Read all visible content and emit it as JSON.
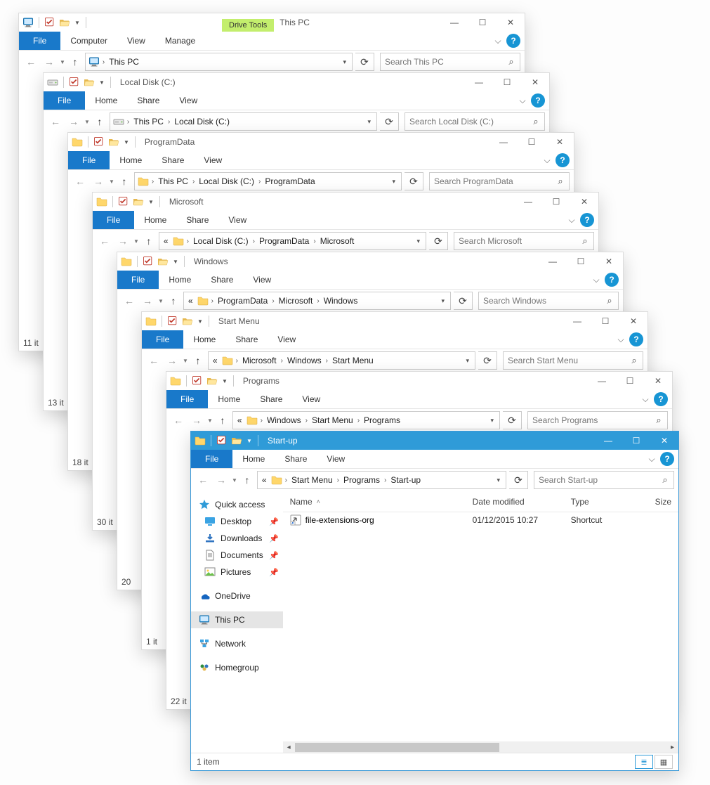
{
  "ribbon": {
    "file": "File",
    "home": "Home",
    "share": "Share",
    "view": "View",
    "computer": "Computer",
    "manage": "Manage",
    "drive_tools": "Drive Tools",
    "help": "?"
  },
  "win_buttons": {
    "min": "—",
    "max": "☐",
    "close": "✕"
  },
  "nav": {
    "back": "←",
    "fwd": "→",
    "up": "↑",
    "refresh": "↻",
    "search_icon": "⌕",
    "dd": "▾",
    "chev": "›",
    "ellipsis": "«"
  },
  "windows": [
    {
      "id": "w0",
      "title": "This PC",
      "icon": "pc",
      "tabs": [
        "file",
        "computer",
        "view"
      ],
      "extra_tool": "drive_tools",
      "breadcrumb": [
        {
          "icon": "pc"
        },
        "This PC"
      ],
      "search_ph": "Search This PC",
      "status": "11 it"
    },
    {
      "id": "w1",
      "title": "Local Disk (C:)",
      "icon": "drive",
      "tabs": [
        "file",
        "home",
        "share",
        "view"
      ],
      "breadcrumb": [
        {
          "icon": "drive"
        },
        "This PC",
        "Local Disk (C:)"
      ],
      "search_ph": "Search Local Disk (C:)",
      "status": "13 it"
    },
    {
      "id": "w2",
      "title": "ProgramData",
      "icon": "folder",
      "tabs": [
        "file",
        "home",
        "share",
        "view"
      ],
      "breadcrumb": [
        {
          "icon": "folder"
        },
        "This PC",
        "Local Disk (C:)",
        "ProgramData"
      ],
      "search_ph": "Search ProgramData",
      "status": "18 it"
    },
    {
      "id": "w3",
      "title": "Microsoft",
      "icon": "folder",
      "tabs": [
        "file",
        "home",
        "share",
        "view"
      ],
      "breadcrumb_prefix": "«",
      "breadcrumb": [
        {
          "icon": "folder"
        },
        "Local Disk (C:)",
        "ProgramData",
        "Microsoft"
      ],
      "search_ph": "Search Microsoft",
      "status": "30 it"
    },
    {
      "id": "w4",
      "title": "Windows",
      "icon": "folder",
      "tabs": [
        "file",
        "home",
        "share",
        "view"
      ],
      "breadcrumb_prefix": "«",
      "breadcrumb": [
        {
          "icon": "folder"
        },
        "ProgramData",
        "Microsoft",
        "Windows"
      ],
      "search_ph": "Search Windows",
      "status": "20"
    },
    {
      "id": "w5",
      "title": "Start Menu",
      "icon": "folder",
      "tabs": [
        "file",
        "home",
        "share",
        "view"
      ],
      "breadcrumb_prefix": "«",
      "breadcrumb": [
        {
          "icon": "folder"
        },
        "Microsoft",
        "Windows",
        "Start Menu"
      ],
      "search_ph": "Search Start Menu",
      "status": "1 it"
    },
    {
      "id": "w6",
      "title": "Programs",
      "icon": "folder",
      "tabs": [
        "file",
        "home",
        "share",
        "view"
      ],
      "breadcrumb_prefix": "«",
      "breadcrumb": [
        {
          "icon": "folder"
        },
        "Windows",
        "Start Menu",
        "Programs"
      ],
      "search_ph": "Search Programs",
      "status": "22 it"
    },
    {
      "id": "w7",
      "title": "Start-up",
      "icon": "folder",
      "active": true,
      "tabs": [
        "file",
        "home",
        "share",
        "view"
      ],
      "breadcrumb_prefix": "«",
      "breadcrumb": [
        {
          "icon": "folder"
        },
        "Start Menu",
        "Programs",
        "Start-up"
      ],
      "search_ph": "Search Start-up",
      "status": "1 item"
    }
  ],
  "active": {
    "tree": {
      "quick": "Quick access",
      "pinned": [
        {
          "icon": "desktop",
          "label": "Desktop",
          "pin": true
        },
        {
          "icon": "download",
          "label": "Downloads",
          "pin": true
        },
        {
          "icon": "document",
          "label": "Documents",
          "pin": true
        },
        {
          "icon": "picture",
          "label": "Pictures",
          "pin": true
        }
      ],
      "roots": [
        {
          "icon": "onedrive",
          "label": "OneDrive"
        },
        {
          "icon": "pc",
          "label": "This PC",
          "sel": true
        },
        {
          "icon": "network",
          "label": "Network"
        },
        {
          "icon": "homegroup",
          "label": "Homegroup"
        }
      ]
    },
    "columns": {
      "name": "Name",
      "date": "Date modified",
      "type": "Type",
      "size": "Size"
    },
    "rows": [
      {
        "name": "file-extensions-org",
        "date": "01/12/2015 10:27",
        "type": "Shortcut"
      }
    ]
  }
}
